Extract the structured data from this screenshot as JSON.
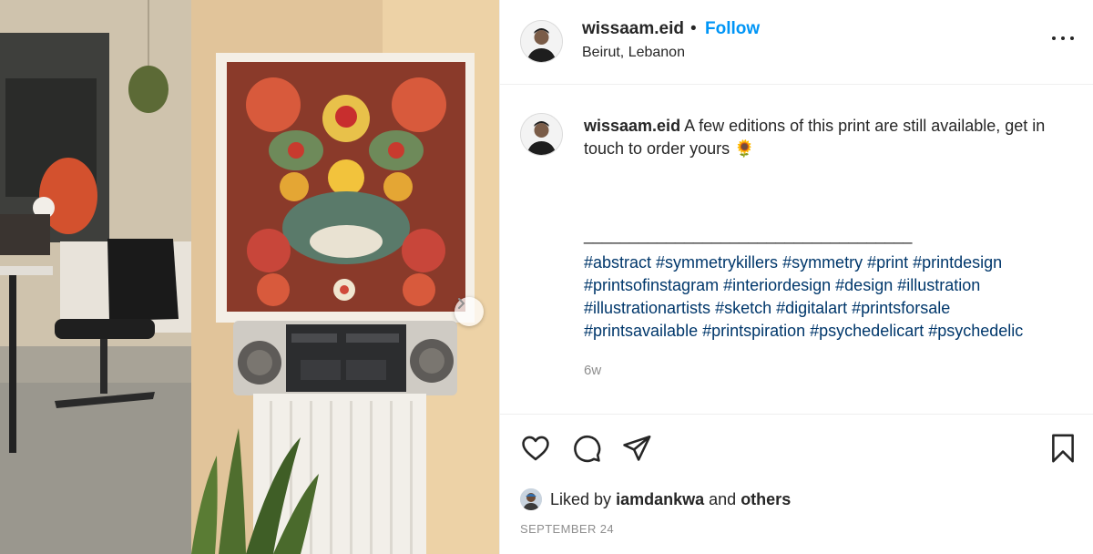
{
  "post": {
    "username": "wissaam.eid",
    "separator": "•",
    "follow_label": "Follow",
    "location": "Beirut, Lebanon",
    "more_icon": "more-horizontal-icon"
  },
  "caption": {
    "username": "wissaam.eid",
    "text": "A few editions of this print are still available, get in touch to order yours 🌻",
    "separator_line": "____________________________________",
    "hashtags": [
      "#abstract",
      "#symmetrykillers",
      "#symmetry",
      "#print",
      "#printdesign",
      "#printsofinstagram",
      "#interiordesign",
      "#design",
      "#illustration",
      "#illustrationartists",
      "#sketch",
      "#digitalart",
      "#printsforsale",
      "#printsavailable",
      "#printspiration",
      "#psychedelicart",
      "#psychedelic"
    ],
    "age": "6w"
  },
  "actions": {
    "like_icon": "heart-icon",
    "comment_icon": "comment-icon",
    "share_icon": "paper-plane-icon",
    "save_icon": "bookmark-icon"
  },
  "likes": {
    "prefix": "Liked by",
    "user": "iamdankwa",
    "joiner": "and",
    "others": "others"
  },
  "date": "SEPTEMBER 24",
  "colors": {
    "follow_blue": "#0095f6",
    "hashtag_blue": "#00376b",
    "muted_gray": "#8e8e8e",
    "divider": "#efefef"
  }
}
